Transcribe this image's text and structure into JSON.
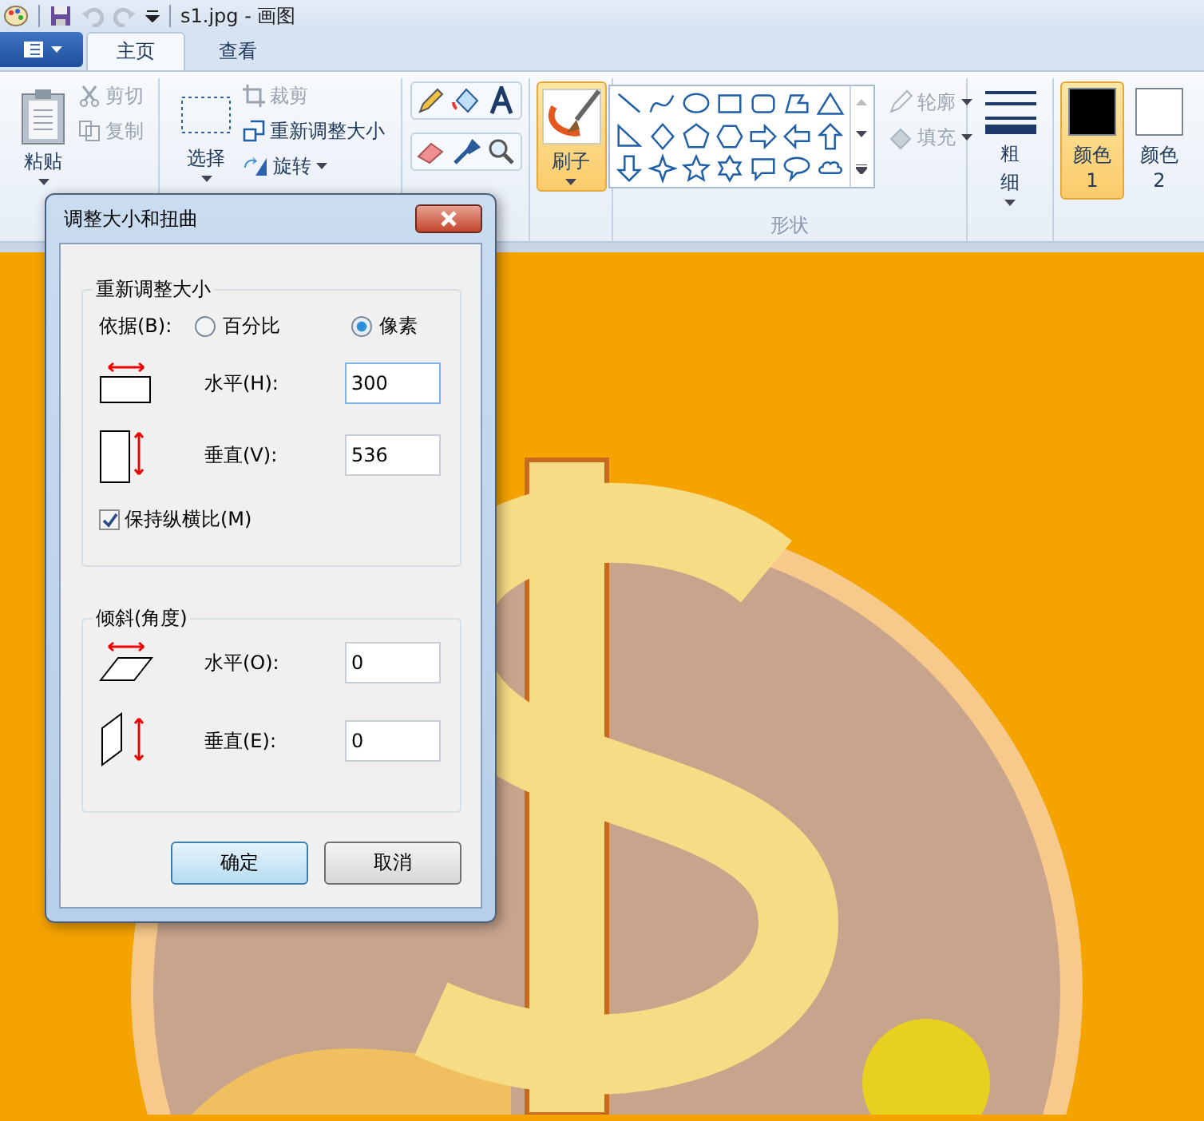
{
  "window": {
    "title": "s1.jpg - 画图"
  },
  "tabs": [
    {
      "label": "主页",
      "selected": true
    },
    {
      "label": "查看",
      "selected": false
    }
  ],
  "ribbon": {
    "paste": {
      "label": "粘贴"
    },
    "clipboard": [
      {
        "kind": "cut",
        "label": "剪切",
        "disabled": true
      },
      {
        "kind": "copy",
        "label": "复制",
        "disabled": true
      }
    ],
    "select": {
      "label": "选择"
    },
    "image": [
      {
        "kind": "crop",
        "label": "裁剪",
        "disabled": true
      },
      {
        "kind": "resize",
        "label": "重新调整大小",
        "disabled": false
      },
      {
        "kind": "rotate",
        "label": "旋转",
        "disabled": false
      }
    ],
    "brush": {
      "label": "刷子",
      "selected": true
    },
    "shape_options": [
      {
        "kind": "outline",
        "label": "轮廓",
        "disabled": true
      },
      {
        "kind": "fill",
        "label": "填充",
        "disabled": true
      }
    ],
    "shapes_label": "形状",
    "size": {
      "label": "粗细"
    },
    "colors": [
      {
        "label": "颜色 1",
        "color": "#000000",
        "selected": true
      },
      {
        "label": "颜色 2",
        "color": "#ffffff",
        "selected": false
      }
    ]
  },
  "dialog": {
    "title": "调整大小和扭曲",
    "resize": {
      "title": "重新调整大小",
      "by_label": "依据(B):",
      "options": [
        {
          "label": "百分比",
          "selected": false
        },
        {
          "label": "像素",
          "selected": true
        }
      ],
      "fields": [
        {
          "kind": "horizontal",
          "label": "水平(H):",
          "value": "300",
          "focused": true
        },
        {
          "kind": "vertical",
          "label": "垂直(V):",
          "value": "536",
          "focused": false
        }
      ],
      "keep_ratio": {
        "label": "保持纵横比(M)",
        "checked": true
      }
    },
    "skew": {
      "title": "倾斜(角度)",
      "fields": [
        {
          "kind": "horizontal",
          "label": "水平(O):",
          "value": "0",
          "focused": false
        },
        {
          "kind": "vertical",
          "label": "垂直(E):",
          "value": "0",
          "focused": false
        }
      ]
    },
    "buttons": [
      {
        "label": "确定",
        "default": true
      },
      {
        "label": "取消",
        "default": false
      }
    ]
  }
}
